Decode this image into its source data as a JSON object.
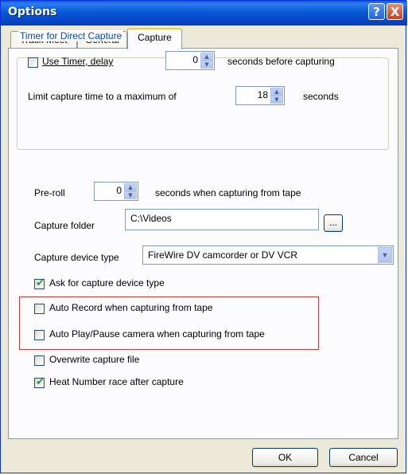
{
  "window": {
    "title": "Options",
    "help_label": "?",
    "close_label": "X"
  },
  "tabs": [
    {
      "label": "Track Meet"
    },
    {
      "label": "General"
    },
    {
      "label": "Capture",
      "active": true
    }
  ],
  "timer_group": {
    "legend": "Timer for Direct Capture",
    "use_timer_label": "Use Timer, delay",
    "use_timer_checked": false,
    "delay_value": "0",
    "delay_suffix": "seconds before capturing",
    "limit_label": "Limit capture time to a maximum of",
    "limit_value": "18",
    "limit_suffix": "seconds"
  },
  "preroll": {
    "label": "Pre-roll",
    "value": "0",
    "suffix": "seconds when capturing from tape"
  },
  "capture_folder": {
    "label": "Capture folder",
    "value": "C:\\Videos",
    "browse_label": "..."
  },
  "device_type": {
    "label": "Capture device type",
    "selected": "FireWire DV camcorder or DV VCR"
  },
  "checkboxes": [
    {
      "label": "Ask for capture device type",
      "checked": true
    },
    {
      "label": "Auto Record when capturing from tape",
      "checked": false
    },
    {
      "label": "Auto Play/Pause camera when capturing from tape",
      "checked": false
    },
    {
      "label": "Overwrite capture file",
      "checked": false
    },
    {
      "label": "Heat Number race after capture",
      "checked": true
    }
  ],
  "buttons": {
    "ok": "OK",
    "cancel": "Cancel"
  },
  "colors": {
    "titlebar": "#0a5bd7",
    "highlight_box": "#d23a3a",
    "legend_text": "#0046d5",
    "check_mark": "#21a121"
  }
}
